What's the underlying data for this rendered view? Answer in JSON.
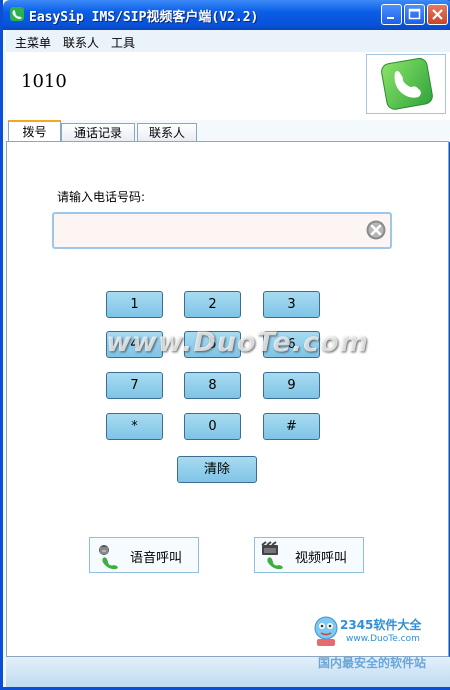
{
  "window": {
    "title": "EasySip IMS/SIP视频客户端(V2.2)"
  },
  "menu": [
    "主菜单",
    "联系人",
    "工具"
  ],
  "header": {
    "number": "1010"
  },
  "tabs": [
    "拨号",
    "通话记录",
    "联系人"
  ],
  "dial": {
    "prompt": "请输入电话号码:",
    "input_value": "",
    "keys": [
      "1",
      "2",
      "3",
      "4",
      "5",
      "6",
      "7",
      "8",
      "9",
      "*",
      "0",
      "#"
    ],
    "clear_label": "清除"
  },
  "calls": {
    "voice_label": "语音呼叫",
    "video_label": "视频呼叫"
  },
  "watermark": "www.DuoTe.com",
  "badge": {
    "brand": "2345软件大全",
    "url": "www.DuoTe.com",
    "slogan": "国内最安全的软件站"
  },
  "colors": {
    "titlebar": "#0a5ee6",
    "key": "#8fd0ee",
    "accent_tab": "#f5a623"
  }
}
